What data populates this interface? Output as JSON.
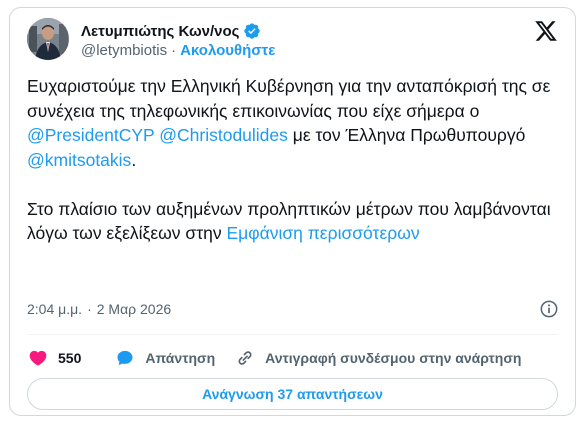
{
  "author": {
    "display_name": "Λετυμπιώτης Κων/νος",
    "handle": "@letymbiotis",
    "follow_label": "Ακολουθήστε",
    "verified": true
  },
  "tweet": {
    "text_1": "Ευχαριστούμε την Ελληνική Κυβέρνηση για την ανταπόκρισή της σε συνέχεια της τηλεφωνικής επικοινωνίας που είχε σήμερα ο ",
    "mention_1": "@PresidentCYP",
    "mention_2": "@Christodulides",
    "text_2": " με τον Έλληνα Πρωθυπουργό ",
    "mention_3": "@kmitsotakis",
    "text_3": ".",
    "text_4": "Στο πλαίσιο των αυξημένων προληπτικών μέτρων που λαμβάνονται λόγω των εξελίξεων στην ",
    "show_more": "Εμφάνιση περισσότερων"
  },
  "meta": {
    "time": "2:04 μ.μ.",
    "separator": "·",
    "date": "2 Μαρ 2026"
  },
  "actions": {
    "like_count": "550",
    "reply_label": "Απάντηση",
    "copy_link_label": "Αντιγραφή συνδέσμου στην ανάρτηση"
  },
  "read_replies_label": "Ανάγνωση 37 απαντήσεων",
  "icons": {
    "verified": "verified-badge-icon",
    "logo": "x-logo-icon",
    "info": "info-icon",
    "like": "heart-icon",
    "reply": "speech-bubble-icon",
    "link": "link-icon"
  },
  "colors": {
    "accent": "#1d9bf0",
    "like": "#f91880",
    "text": "#0f1419",
    "secondary_text": "#536471",
    "border": "#cfd9de"
  }
}
